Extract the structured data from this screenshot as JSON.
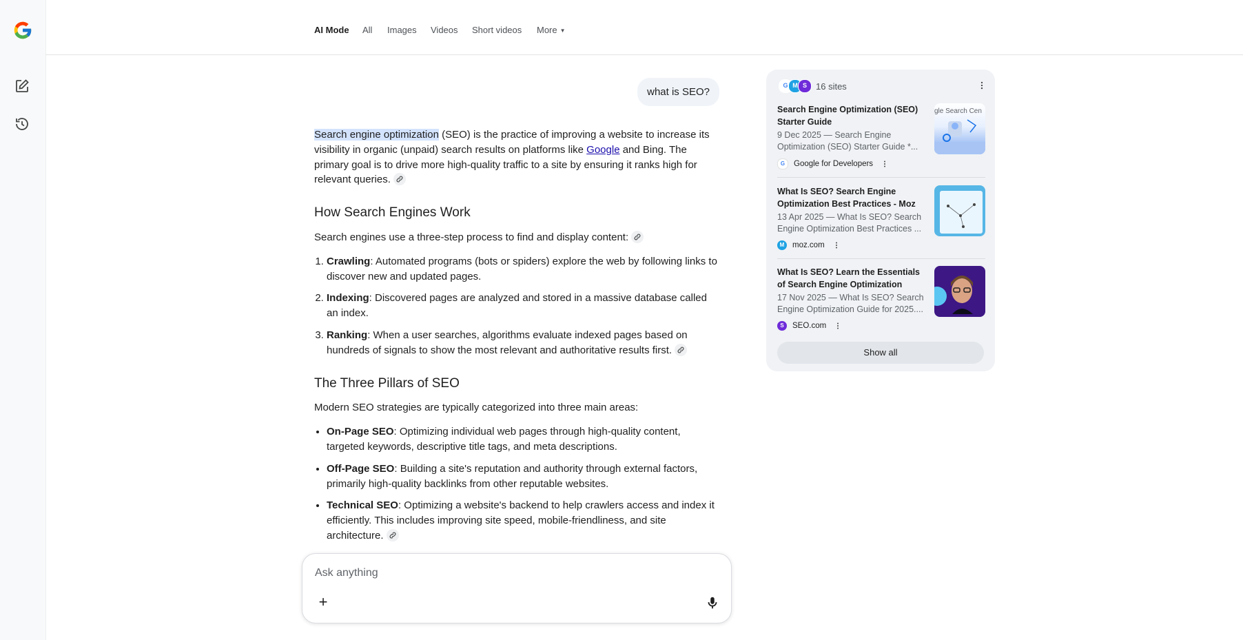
{
  "nav": {
    "tabs": [
      {
        "label": "AI Mode",
        "active": true
      },
      {
        "label": "All"
      },
      {
        "label": "Images"
      },
      {
        "label": "Videos"
      },
      {
        "label": "Short videos"
      },
      {
        "label": "More"
      }
    ]
  },
  "rail": {
    "logo_icon": "google-g-logo",
    "new_chat_icon": "edit-square-icon",
    "history_icon": "history-icon"
  },
  "query": {
    "text": "what is SEO?"
  },
  "answer": {
    "intro": {
      "highlight": "Search engine optimization",
      "part1": " (SEO) is the practice of improving a website to increase its visibility in organic (unpaid) search results on platforms like ",
      "link": "Google",
      "part2": " and Bing. The primary goal is to drive more high-quality traffic to a site by ensuring it ranks high for relevant queries."
    },
    "section1": {
      "heading": "How Search Engines Work",
      "intro": "Search engines use a three-step process to find and display content:",
      "items": [
        {
          "term": "Crawling",
          "text": ": Automated programs (bots or spiders) explore the web by following links to discover new and updated pages."
        },
        {
          "term": "Indexing",
          "text": ": Discovered pages are analyzed and stored in a massive database called an index."
        },
        {
          "term": "Ranking",
          "text": ": When a user searches, algorithms evaluate indexed pages based on hundreds of signals to show the most relevant and authoritative results first."
        }
      ]
    },
    "section2": {
      "heading": "The Three Pillars of SEO",
      "intro": "Modern SEO strategies are typically categorized into three main areas:",
      "items": [
        {
          "term": "On-Page SEO",
          "text": ": Optimizing individual web pages through high-quality content, targeted keywords, descriptive title tags, and meta descriptions."
        },
        {
          "term": "Off-Page SEO",
          "text": ": Building a site's reputation and authority through external factors, primarily high-quality backlinks from other reputable websites."
        },
        {
          "term": "Technical SEO",
          "text": ": Optimizing a website's backend to help crawlers access and index it efficiently. This includes improving site speed, mobile-friendliness, and site architecture."
        }
      ]
    }
  },
  "composer": {
    "placeholder": "Ask anything",
    "plus_label": "+"
  },
  "sources": {
    "count_label": "16 sites",
    "cards": [
      {
        "title": "Search Engine Optimization (SEO) Starter Guide",
        "snippet": "9 Dec 2025 — Search Engine Optimization (SEO) Starter Guide *...",
        "source": "Google for Developers",
        "fav_color": "#ffffff"
      },
      {
        "title": "What Is SEO? Search Engine Optimization Best Practices - Moz",
        "snippet": "13 Apr 2025 — What Is SEO? Search Engine Optimization Best Practices ...",
        "source": "moz.com",
        "fav_color": "#1fa2e3"
      },
      {
        "title": "What Is SEO? Learn the Essentials of Search Engine Optimization",
        "snippet": "17 Nov 2025 — What Is SEO? Search Engine Optimization Guide for 2025....",
        "source": "SEO.com",
        "fav_color": "#6f2bd9"
      }
    ],
    "show_all": "Show all",
    "thumb1_text": "gle Search Cen"
  },
  "colors": {
    "accent_link": "#1a0dab",
    "highlight": "#d3e3fd",
    "panel_bg": "#f0f2f5"
  }
}
